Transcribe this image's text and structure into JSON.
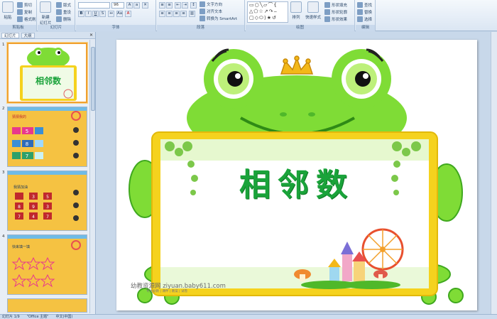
{
  "ribbon": {
    "clipboard": {
      "paste": "粘贴",
      "cut": "剪切",
      "copy": "复制",
      "format_painter": "格式刷",
      "label": "剪贴板"
    },
    "slides": {
      "new_slide": "新建\n幻灯片",
      "layout": "版式",
      "reset": "重设",
      "delete": "删除",
      "label": "幻灯片"
    },
    "font": {
      "size": "96",
      "label": "字体"
    },
    "paragraph": {
      "text_direction": "文字方向",
      "align_text": "对齐文本",
      "smartart": "转换为 SmartArt",
      "label": "段落"
    },
    "drawing": {
      "arrange": "排列",
      "quick_styles": "快速样式",
      "shape_fill": "形状填充",
      "shape_outline": "形状轮廓",
      "shape_effects": "形状效果",
      "label": "绘图"
    },
    "editing": {
      "find": "查找",
      "replace": "替换",
      "select": "选择",
      "label": "编辑"
    }
  },
  "panel": {
    "tabs": [
      "幻灯片",
      "大纲"
    ],
    "slides": [
      {
        "num": "1",
        "title": "相邻数"
      },
      {
        "num": "2",
        "title": "猜猜我的",
        "values": [
          "5",
          "8",
          "7"
        ]
      },
      {
        "num": "3",
        "title": "我猜加油",
        "values": [
          "3",
          "5",
          "8",
          "9",
          "3",
          "7",
          "4",
          "7"
        ]
      },
      {
        "num": "4",
        "title": "快来填一填"
      }
    ]
  },
  "slide": {
    "title": "相邻数",
    "watermark": "幼教资源网 ziyuan.baby611.com",
    "watermark_sub": "专注幼教 | 课件 | 教案 | 试卷"
  },
  "statusbar": {
    "slide_info": "幻灯片 1/9",
    "theme": "\"Office 主题\"",
    "language": "中文(中国)"
  },
  "colors": {
    "frog_green": "#7fdc36",
    "frame_yellow": "#f5d21e",
    "title_green": "#1aa33a",
    "selection": "#f0a030"
  }
}
